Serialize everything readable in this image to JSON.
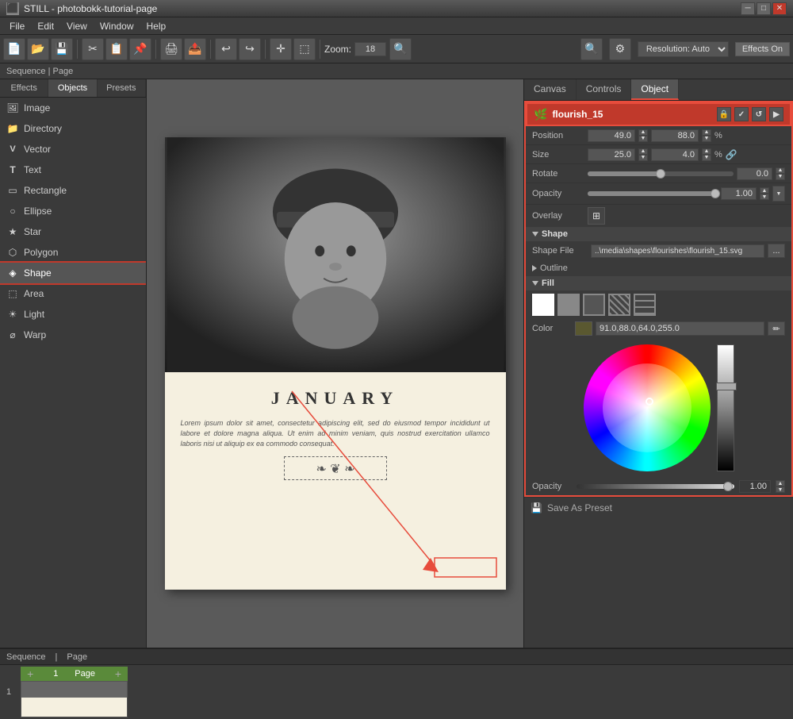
{
  "app": {
    "title": "STILL - photobokk-tutorial-page",
    "icon": "⬛"
  },
  "titlebar": {
    "title": "STILL - photobokk-tutorial-page",
    "minimize": "─",
    "maximize": "□",
    "close": "✕"
  },
  "menubar": {
    "items": [
      "File",
      "Edit",
      "View",
      "Window",
      "Help"
    ]
  },
  "toolbar": {
    "zoom_label": "Zoom: 18",
    "resolution_label": "Resolution: Auto",
    "effects_label": "Effects On",
    "sequence_page": "Sequence | Page"
  },
  "left_panel": {
    "tabs": [
      "Effects",
      "Objects",
      "Presets"
    ],
    "active_tab": "Objects",
    "items": [
      {
        "label": "Image",
        "icon": "🖼"
      },
      {
        "label": "Directory",
        "icon": "📁"
      },
      {
        "label": "Vector",
        "icon": "V"
      },
      {
        "label": "Text",
        "icon": "T"
      },
      {
        "label": "Rectangle",
        "icon": "▭"
      },
      {
        "label": "Ellipse",
        "icon": "○"
      },
      {
        "label": "Star",
        "icon": "★"
      },
      {
        "label": "Polygon",
        "icon": "⬡"
      },
      {
        "label": "Shape",
        "icon": "◈"
      },
      {
        "label": "Area",
        "icon": "⬚"
      },
      {
        "label": "Light",
        "icon": "☀"
      },
      {
        "label": "Warp",
        "icon": "⌀"
      }
    ],
    "selected_item": "Shape"
  },
  "right_panel": {
    "tabs": [
      "Canvas",
      "Controls",
      "Object"
    ],
    "active_tab": "Object",
    "object": {
      "name": "flourish_15",
      "lock_icon": "🔒",
      "check_icon": "✓",
      "refresh_icon": "↺",
      "arrow_icon": "▶",
      "position_x": "49.0",
      "position_y": "88.0",
      "size_w": "25.0",
      "size_h": "4.0",
      "rotate_value": "0.0",
      "opacity_value": "1.00",
      "overlay_label": "Overlay",
      "shape_section": "Shape",
      "shape_file_label": "Shape File",
      "shape_file_value": "..\\media\\shapes\\flourishes\\flourish_15.svg",
      "shape_file_btn": "...",
      "outline_label": "Outline",
      "fill_label": "Fill",
      "color_label": "Color",
      "color_value": "91.0,88.0,64.0,255.0",
      "fill_opacity_label": "Opacity",
      "fill_opacity_value": "1.00",
      "rotate_slider_pos": "50%",
      "opacity_slider_pos": "98%"
    }
  },
  "page": {
    "title": "JANUARY",
    "text": "Lorem ipsum dolor sit amet, consectetur adipiscing elit, sed do eiusmod tempor incididunt ut labore et dolore magna aliqua. Ut enim ad minim veniam, quis nostrud exercitation ullamco laboris nisi ut aliquip ex ea commodo consequat.",
    "flourish_label": "flourish ornament"
  },
  "bottom": {
    "sequence_label": "Sequence",
    "page_label": "Page",
    "page_num": "1",
    "seq_num": "1"
  },
  "fill_swatches": [
    {
      "type": "solid",
      "color": "#fff"
    },
    {
      "type": "gray",
      "color": "#888"
    },
    {
      "type": "darkgray",
      "color": "#555"
    },
    {
      "type": "pattern",
      "color": "pattern"
    },
    {
      "type": "grid",
      "color": "grid"
    }
  ]
}
